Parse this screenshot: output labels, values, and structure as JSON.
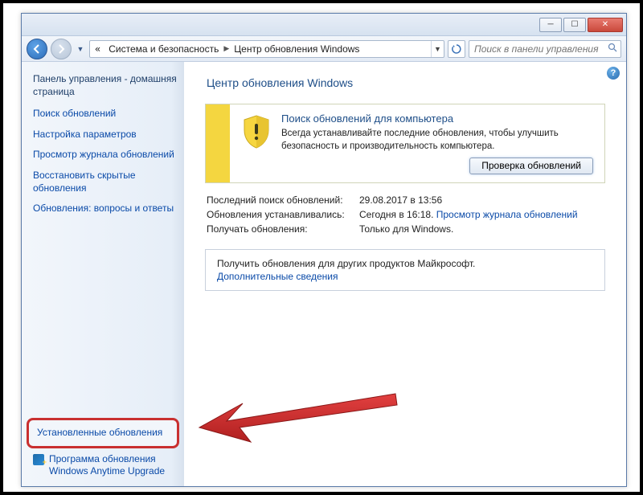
{
  "breadcrumb": {
    "item1": "Система и безопасность",
    "item2": "Центр обновления Windows"
  },
  "search": {
    "placeholder": "Поиск в панели управления"
  },
  "sidebar": {
    "header": "Панель управления - домашняя страница",
    "links": {
      "l0": "Поиск обновлений",
      "l1": "Настройка параметров",
      "l2": "Просмотр журнала обновлений",
      "l3": "Восстановить скрытые обновления",
      "l4": "Обновления: вопросы и ответы"
    },
    "bottom": {
      "installed": "Установленные обновления",
      "upgrade": "Программа обновления Windows Anytime Upgrade"
    }
  },
  "main": {
    "title": "Центр обновления Windows",
    "warn": {
      "heading": "Поиск обновлений для компьютера",
      "body": "Всегда устанавливайте последние обновления, чтобы улучшить безопасность и производительность компьютера.",
      "button": "Проверка обновлений"
    },
    "info": {
      "k0": "Последний поиск обновлений:",
      "v0": "29.08.2017 в 13:56",
      "k1": "Обновления устанавливались:",
      "v1a": "Сегодня в 16:18.",
      "v1b": "Просмотр журнала обновлений",
      "k2": "Получать обновления:",
      "v2": "Только для Windows."
    },
    "extra": {
      "line1": "Получить обновления для других продуктов Майкрософт.",
      "line2": "Дополнительные сведения"
    }
  }
}
